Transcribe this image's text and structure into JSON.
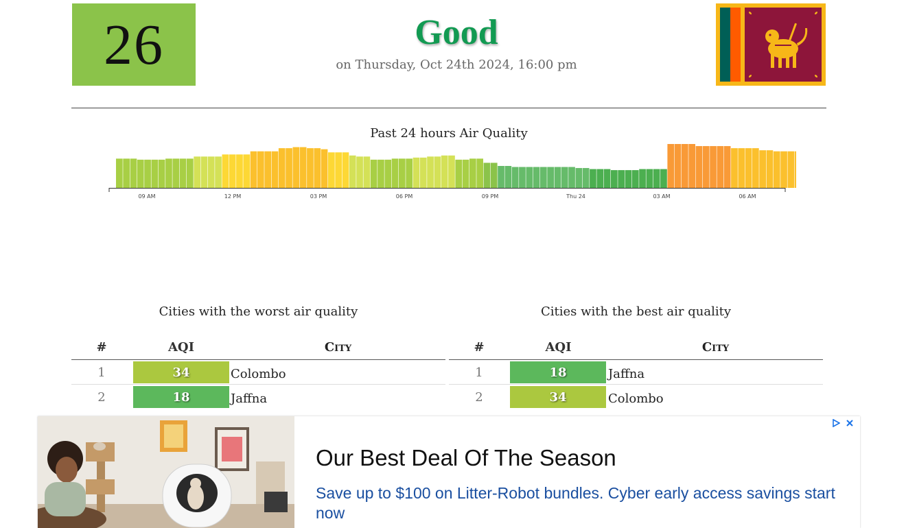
{
  "summary": {
    "aqi_value": "26",
    "aqi_color": "#8bc34a",
    "status": "Good",
    "status_color": "#129a52",
    "timestamp": "on Thursday, Oct 24th 2024, 16:00 pm",
    "flag_icon": "sri-lanka-flag-icon"
  },
  "chart": {
    "title": "Past 24 hours Air Quality",
    "x_tick_labels": [
      "09 AM",
      "12 PM",
      "03 PM",
      "06 PM",
      "09 PM",
      "Thu 24",
      "03 AM",
      "06 AM"
    ]
  },
  "chart_data": {
    "type": "bar",
    "title": "Past 24 hours Air Quality",
    "xlabel": "",
    "ylabel": "",
    "grid": false,
    "x_tick_labels": [
      "09 AM",
      "12 PM",
      "03 PM",
      "06 PM",
      "09 PM",
      "Thu 24",
      "03 AM",
      "06 AM"
    ],
    "values": [
      28,
      28,
      28,
      27,
      27,
      27,
      27,
      28,
      28,
      28,
      28,
      30,
      30,
      30,
      30,
      32,
      32,
      32,
      32,
      35,
      35,
      35,
      35,
      38,
      38,
      39,
      39,
      38,
      38,
      37,
      34,
      34,
      34,
      31,
      30,
      30,
      27,
      27,
      27,
      28,
      28,
      28,
      29,
      29,
      30,
      30,
      31,
      31,
      27,
      27,
      28,
      28,
      24,
      24,
      21,
      21,
      20,
      20,
      20,
      20,
      20,
      20,
      20,
      20,
      20,
      19,
      19,
      18,
      18,
      18,
      17,
      17,
      17,
      17,
      18,
      18,
      18,
      18,
      42,
      42,
      42,
      42,
      40,
      40,
      40,
      40,
      40,
      38,
      38,
      38,
      38,
      36,
      36,
      35,
      35,
      35,
      35,
      23
    ]
  },
  "worst_table": {
    "title": "Cities with the worst air quality",
    "headers": {
      "rank": "#",
      "aqi": "AQI",
      "city": "City"
    },
    "rows": [
      {
        "rank": "1",
        "aqi": "34",
        "city": "Colombo",
        "color": "#abc83f"
      },
      {
        "rank": "2",
        "aqi": "18",
        "city": "Jaffna",
        "color": "#5cb85c"
      }
    ]
  },
  "best_table": {
    "title": "Cities with the best air quality",
    "headers": {
      "rank": "#",
      "aqi": "AQI",
      "city": "City"
    },
    "rows": [
      {
        "rank": "1",
        "aqi": "18",
        "city": "Jaffna",
        "color": "#5cb85c"
      },
      {
        "rank": "2",
        "aqi": "34",
        "city": "Colombo",
        "color": "#abc83f"
      }
    ]
  },
  "ad": {
    "headline": "Our Best Deal Of The Season",
    "body": "Save up to $100 on Litter-Robot bundles. Cyber early access savings start now",
    "adchoices_icon": "adchoices-icon",
    "close_icon": "close-icon"
  }
}
